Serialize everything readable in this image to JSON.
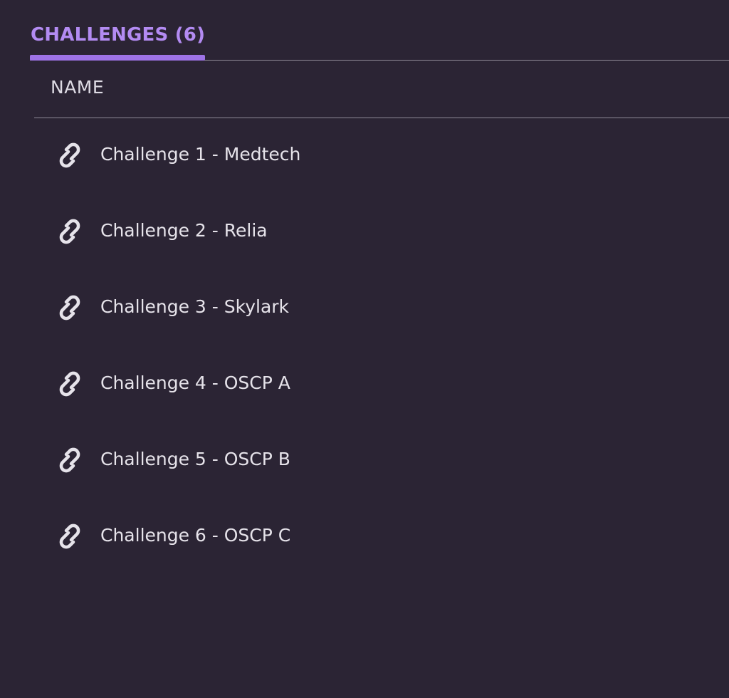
{
  "tabs": {
    "active_label": "CHALLENGES (6)"
  },
  "table": {
    "column_name": "NAME",
    "rows": [
      {
        "label": "Challenge 1 - Medtech",
        "icon": "link-icon"
      },
      {
        "label": "Challenge 2 - Relia",
        "icon": "link-icon"
      },
      {
        "label": "Challenge 3 - Skylark",
        "icon": "link-icon"
      },
      {
        "label": "Challenge 4 - OSCP A",
        "icon": "link-icon"
      },
      {
        "label": "Challenge 5 - OSCP B",
        "icon": "link-icon"
      },
      {
        "label": "Challenge 6 - OSCP C",
        "icon": "link-icon"
      }
    ]
  },
  "colors": {
    "background": "#2b2434",
    "accent": "#b38bf2",
    "text": "#e6e3ea",
    "divider": "#8f8a97"
  }
}
